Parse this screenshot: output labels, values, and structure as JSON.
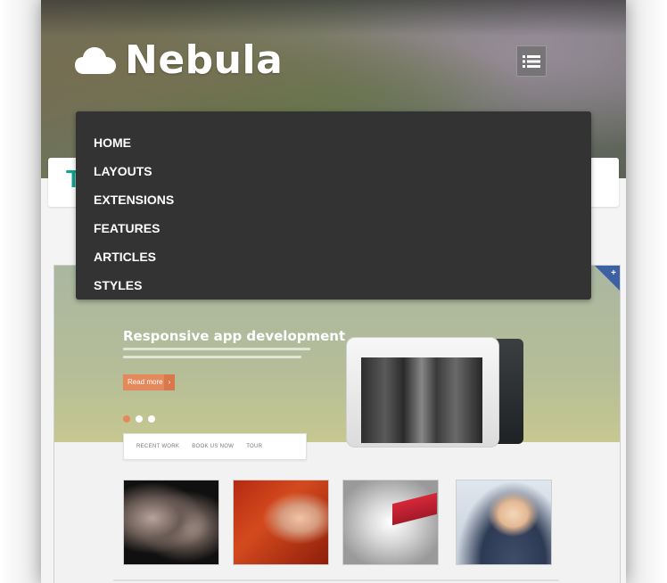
{
  "header": {
    "logo_text": "Nebula",
    "logo_icon": "cloud-icon",
    "menu_toggle_icon": "list-icon"
  },
  "nav": {
    "items": [
      {
        "label": "HOME"
      },
      {
        "label": "LAYOUTS"
      },
      {
        "label": "EXTENSIONS"
      },
      {
        "label": "FEATURES"
      },
      {
        "label": "ARTICLES"
      },
      {
        "label": "STYLES"
      }
    ]
  },
  "content": {
    "title_fragment": "T"
  },
  "preview": {
    "headline": "Responsive app development",
    "button_label": "Read more",
    "tabs": [
      "RECENT WORK",
      "BOOK US NOW",
      "TOUR"
    ]
  },
  "colors": {
    "accent": "#12a38e",
    "dropdown_bg": "#333333",
    "button": "#e5895c"
  }
}
